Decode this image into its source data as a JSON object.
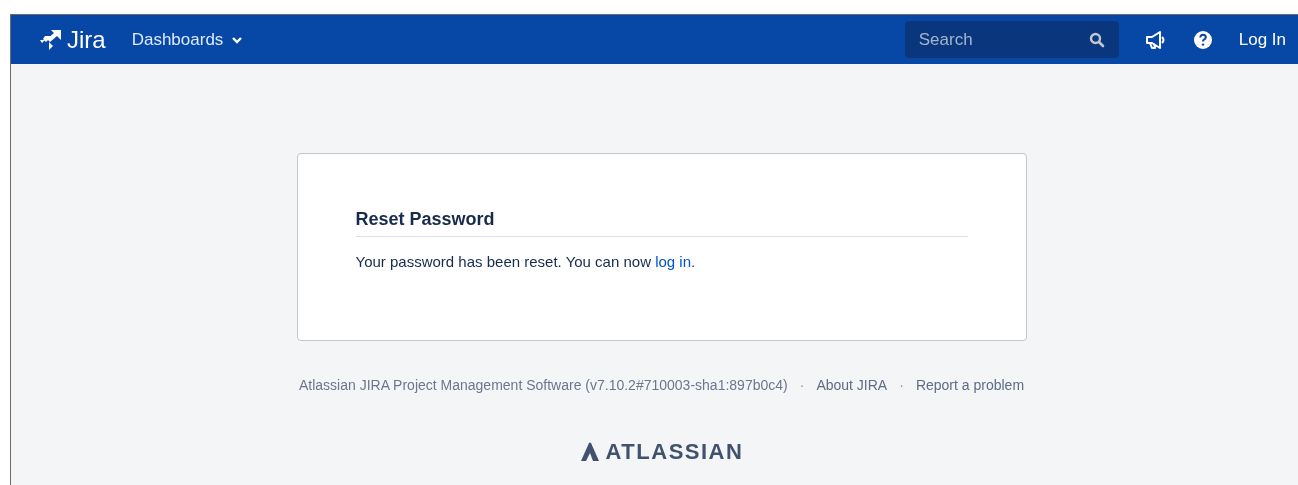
{
  "header": {
    "logo": "Jira",
    "nav": [
      {
        "label": "Dashboards",
        "dropdown": true
      }
    ],
    "search": {
      "placeholder": "Search"
    },
    "login": "Log In"
  },
  "card": {
    "title": "Reset Password",
    "message": {
      "text": "Your password has been reset. You can now ",
      "link": "log in",
      "after": "."
    }
  },
  "footer": {
    "items": [
      {
        "kind": "text",
        "label": "Atlassian JIRA Project Management Software (v7.10.2#710003-sha1:897b0c4)"
      },
      {
        "kind": "separator",
        "label": "·"
      },
      {
        "kind": "link",
        "label": "About JIRA"
      },
      {
        "kind": "separator",
        "label": "·"
      },
      {
        "kind": "link",
        "label": "Report a problem"
      }
    ],
    "brand": "ATLASSIAN"
  }
}
